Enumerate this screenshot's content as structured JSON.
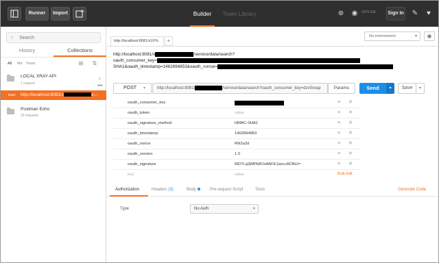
{
  "topbar": {
    "runner_label": "Runner",
    "import_label": "Import",
    "builder_label": "Builder",
    "team_library_label": "Team Library",
    "offline_label": "OFFLINE",
    "signin_label": "Sign In"
  },
  "sidebar": {
    "search_placeholder": "Search",
    "tab_history": "History",
    "tab_collections": "Collections",
    "filter_all": "All",
    "filter_me": "Me",
    "filter_team": "Team",
    "collections": [
      {
        "name": "LOCAL XRAY API",
        "sub": "1 request"
      },
      {
        "name": "Postman Echo",
        "sub": "20 requests"
      }
    ],
    "active_request": {
      "method": "POST",
      "url_prefix": "http://localhost:8081/x",
      "url_suffix": "x..."
    }
  },
  "main": {
    "tab_label": "http://localhost:8081/x1F%",
    "environment": "No environment",
    "url_display": {
      "line1_prefix": "http://localhost:8081/x",
      "line1_suffix": "/service/data/search?",
      "line2_prefix": "oauth_consumer_key=",
      "line3_prefix": "SHA1&oauth_timestamp=1462894853&oauth_nonce="
    },
    "method": "POST",
    "url_input_prefix": "http://localhost:8081/",
    "url_input_suffix": "/service/data/search?oauth_consumer_key=dzv5xxap",
    "params_label": "Params",
    "send_label": "Send",
    "save_label": "Save",
    "params": [
      {
        "key": "oauth_consumer_key",
        "value": ""
      },
      {
        "key": "oauth_token",
        "value": "value"
      },
      {
        "key": "oauth_signature_method",
        "value": "HMAC-SHA1"
      },
      {
        "key": "oauth_timestamp",
        "value": "1462894853"
      },
      {
        "key": "oauth_nonce",
        "value": "RN2a2d"
      },
      {
        "key": "oauth_version",
        "value": "1.0"
      },
      {
        "key": "oauth_signature",
        "value": "MD7Lq2jMPb8Oo8AFE1axccACfbU="
      }
    ],
    "new_param": {
      "key": "key",
      "value": "value"
    },
    "bulk_edit_label": "Bulk Edit",
    "subtabs": {
      "authorization": "Authorization",
      "headers": "Headers",
      "headers_count": "(3)",
      "body": "Body",
      "prerequest": "Pre-request Script",
      "tests": "Tests",
      "generate_code": "Generate Code"
    },
    "auth": {
      "type_label": "Type",
      "type_value": "No Auth"
    }
  },
  "colors": {
    "accent": "#f47023",
    "primary": "#1d8ee8",
    "topbar": "#2f2f2f"
  }
}
